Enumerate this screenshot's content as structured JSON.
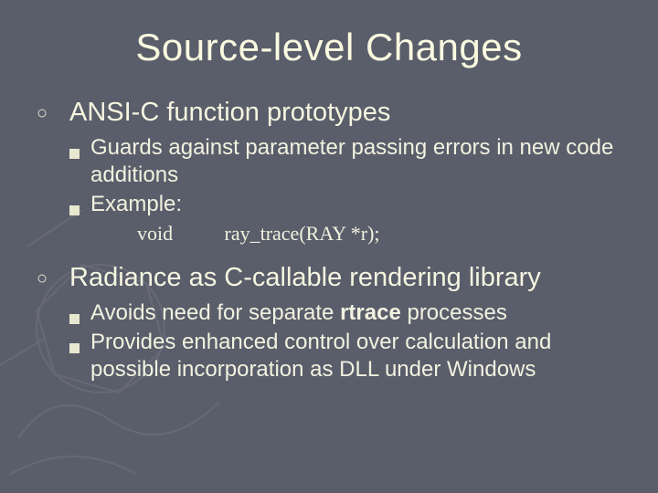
{
  "title": "Source-level Changes",
  "items": [
    {
      "text": "ANSI-C function prototypes",
      "subs": [
        {
          "text": "Guards against parameter passing errors in new code additions"
        },
        {
          "text": "Example:"
        }
      ],
      "code": {
        "keyword": "void",
        "call": "ray_trace(RAY *r);"
      }
    },
    {
      "text": "Radiance as C-callable rendering library",
      "subs": [
        {
          "html": "Avoids need for separate <span class=\"bold\">rtrace</span> processes"
        },
        {
          "text": "Provides enhanced control over calculation and possible incorporation as DLL under Windows"
        }
      ]
    }
  ]
}
